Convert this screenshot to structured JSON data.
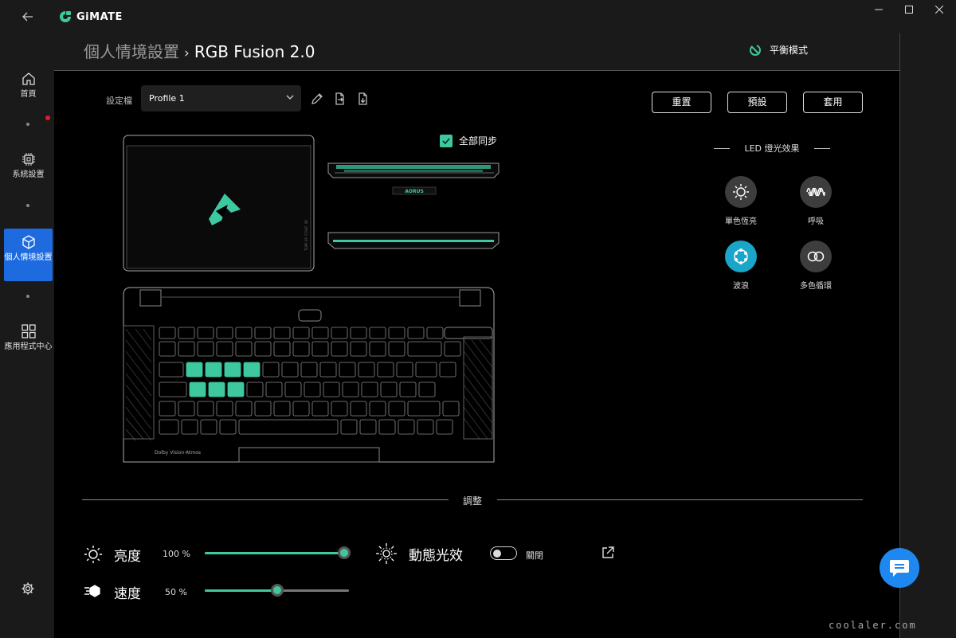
{
  "app": {
    "name": "GiMATE"
  },
  "sidebar": {
    "items": [
      {
        "label": "首頁",
        "icon": "home-icon"
      },
      {
        "label": "系統設置",
        "icon": "chip-icon"
      },
      {
        "label": "個人情境設置",
        "icon": "cube-icon",
        "active": true
      },
      {
        "label": "應用程式中心",
        "icon": "apps-grid-icon"
      }
    ]
  },
  "header": {
    "breadcrumb_parent": "個人情境設置",
    "breadcrumb_separator": "›",
    "breadcrumb_current": "RGB Fusion 2.0",
    "mode_label": "平衡模式"
  },
  "profile": {
    "label": "設定檔",
    "selected": "Profile 1"
  },
  "actions": {
    "reset": "重置",
    "preset": "預設",
    "apply": "套用"
  },
  "sync": {
    "label": "全部同步",
    "checked": true
  },
  "led": {
    "title": "LED 燈光效果",
    "effects": [
      {
        "label": "單色恆亮",
        "icon": "sun-icon"
      },
      {
        "label": "呼吸",
        "icon": "wave-line-icon"
      },
      {
        "label": "波浪",
        "icon": "wave-ring-icon",
        "active": true
      },
      {
        "label": "多色循環",
        "icon": "infinity-icon"
      }
    ]
  },
  "adjust": {
    "title": "調整",
    "brightness": {
      "label": "亮度",
      "value_text": "100 %",
      "value": 1.0
    },
    "speed": {
      "label": "速度",
      "value_text": "50 %",
      "value": 0.5
    },
    "dynamic": {
      "label": "動態光效",
      "state_text": "關閉",
      "on": false
    }
  },
  "keyboard": {
    "brand_text": "Dolby Vision·Atmos",
    "lid_text": "AORUS"
  },
  "watermark": "coolaler.com",
  "colors": {
    "accent": "#3ec8a0",
    "active_nav": "#1e6be0",
    "chat": "#1f87f0"
  }
}
